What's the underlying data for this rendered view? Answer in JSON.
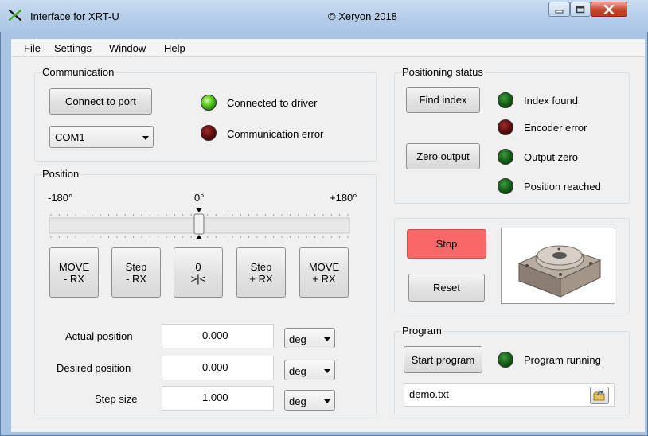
{
  "window": {
    "title": "Interface for XRT-U",
    "copyright": "© Xeryon 2018"
  },
  "menu": [
    "File",
    "Settings",
    "Window",
    "Help"
  ],
  "communication": {
    "group_label": "Communication",
    "connect_button": "Connect to port",
    "port_value": "COM1",
    "connected_label": "Connected to driver",
    "error_label": "Communication error"
  },
  "position": {
    "group_label": "Position",
    "scale_min": "-180°",
    "scale_mid": "0°",
    "scale_max": "+180°",
    "slider_value_fraction": 0.5,
    "buttons": [
      {
        "line1": "MOVE",
        "line2": "- RX"
      },
      {
        "line1": "Step",
        "line2": "- RX"
      },
      {
        "line1": "0",
        "line2": ">|<"
      },
      {
        "line1": "Step",
        "line2": "+ RX"
      },
      {
        "line1": "MOVE",
        "line2": "+ RX"
      }
    ],
    "rows": [
      {
        "label": "Actual position",
        "value": "0.000",
        "unit": "deg"
      },
      {
        "label": "Desired position",
        "value": "0.000",
        "unit": "deg"
      },
      {
        "label": "Step size",
        "value": "1.000",
        "unit": "deg"
      }
    ]
  },
  "status": {
    "group_label": "Positioning status",
    "find_index_button": "Find index",
    "zero_output_button": "Zero output",
    "index_found": "Index found",
    "encoder_error": "Encoder error",
    "output_zero": "Output zero",
    "position_reached": "Position reached"
  },
  "control": {
    "stop_button": "Stop",
    "reset_button": "Reset"
  },
  "program": {
    "group_label": "Program",
    "start_button": "Start program",
    "running_label": "Program running",
    "file_value": "demo.txt"
  },
  "colors": {
    "stop_button": "#f86868",
    "window_chrome": "#a9c4e4"
  }
}
